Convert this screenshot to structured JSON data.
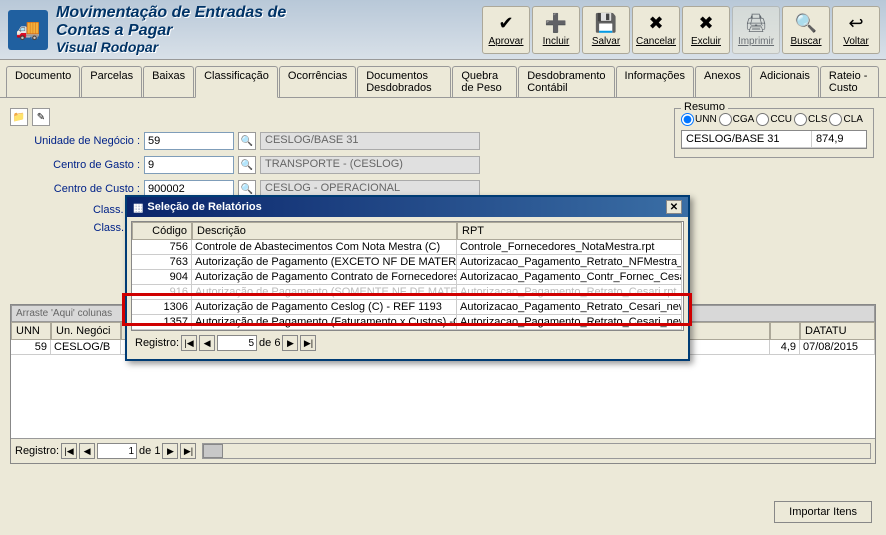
{
  "header": {
    "title_line1": "Movimentação de Entradas de",
    "title_line2": "Contas a Pagar",
    "subtitle": "Visual Rodopar"
  },
  "toolbar": {
    "aprovar": "Aprovar",
    "incluir": "Incluir",
    "salvar": "Salvar",
    "cancelar": "Cancelar",
    "excluir": "Excluir",
    "imprimir": "Imprimir",
    "buscar": "Buscar",
    "voltar": "Voltar"
  },
  "tabs": [
    "Documento",
    "Parcelas",
    "Baixas",
    "Classificação",
    "Ocorrências",
    "Documentos Desdobrados",
    "Quebra de Peso",
    "Desdobramento Contábil",
    "Informações",
    "Anexos",
    "Adicionais",
    "Rateio - Custo"
  ],
  "active_tab": "Classificação",
  "form": {
    "unidade_label": "Unidade de Negócio :",
    "unidade_value": "59",
    "unidade_display": "CESLOG/BASE 31",
    "centro_gasto_label": "Centro de Gasto :",
    "centro_gasto_value": "9",
    "centro_gasto_display": "TRANSPORTE - (CESLOG)",
    "centro_custo_label": "Centro de Custo :",
    "centro_custo_value": "900002",
    "centro_custo_display": "CESLOG - OPERACIONAL",
    "class_sir_label": "Class. Sir",
    "class_an_label": "Class. An"
  },
  "resumo": {
    "title": "Resumo",
    "radios": [
      "UNN",
      "CGA",
      "CCU",
      "CLS",
      "CLA"
    ],
    "selected_radio": "UNN",
    "row_name": "CESLOG/BASE 31",
    "row_value": "874,9"
  },
  "grid_hint": "Arraste 'Aqui' colunas",
  "bottom_grid": {
    "headers": [
      "UNN",
      "Un. Negóci",
      "DATATU"
    ],
    "row": {
      "unn": "59",
      "un_negoci": "CESLOG/B",
      "extra": "4,9",
      "datatu": "07/08/2015"
    }
  },
  "record_nav": {
    "label": "Registro:",
    "current": "1",
    "total": "de 1"
  },
  "modal": {
    "title": "Seleção de Relatórios",
    "headers": [
      "Código",
      "Descrição",
      "RPT"
    ],
    "rows": [
      {
        "codigo": "756",
        "desc": "Controle de Abastecimentos Com Nota Mestra (C)",
        "rpt": "Controle_Fornecedores_NotaMestra.rpt"
      },
      {
        "codigo": "763",
        "desc": "Autorização de Pagamento (EXCETO NF DE MATERIAIS)",
        "rpt": "Autorizacao_Pagamento_Retrato_NFMestra_..."
      },
      {
        "codigo": "904",
        "desc": "Autorização de Pagamento Contrato de Fornecedores",
        "rpt": "Autorizacao_Pagamento_Contr_Fornec_Cesar..."
      },
      {
        "codigo": "916",
        "desc": "Autorização de Pagamento (SOMENTE NF DE MATERIAIS)",
        "rpt": "Autorizacao_Pagamento_Retrato_Cesari.rpt"
      },
      {
        "codigo": "1306",
        "desc": "Autorização de Pagamento Ceslog (C) - REF 1193",
        "rpt": "Autorizacao_Pagamento_Retrato_Cesari_new..."
      },
      {
        "codigo": "1357",
        "desc": "Autorização de Pagamento (Faturamento x Custos) -CESLOG",
        "rpt": "Autorizacao_Pagamento_Retrato_Cesari_new..."
      }
    ],
    "record_label": "Registro:",
    "record_current": "5",
    "record_total": "de 6"
  },
  "importar_label": "Importar Itens"
}
